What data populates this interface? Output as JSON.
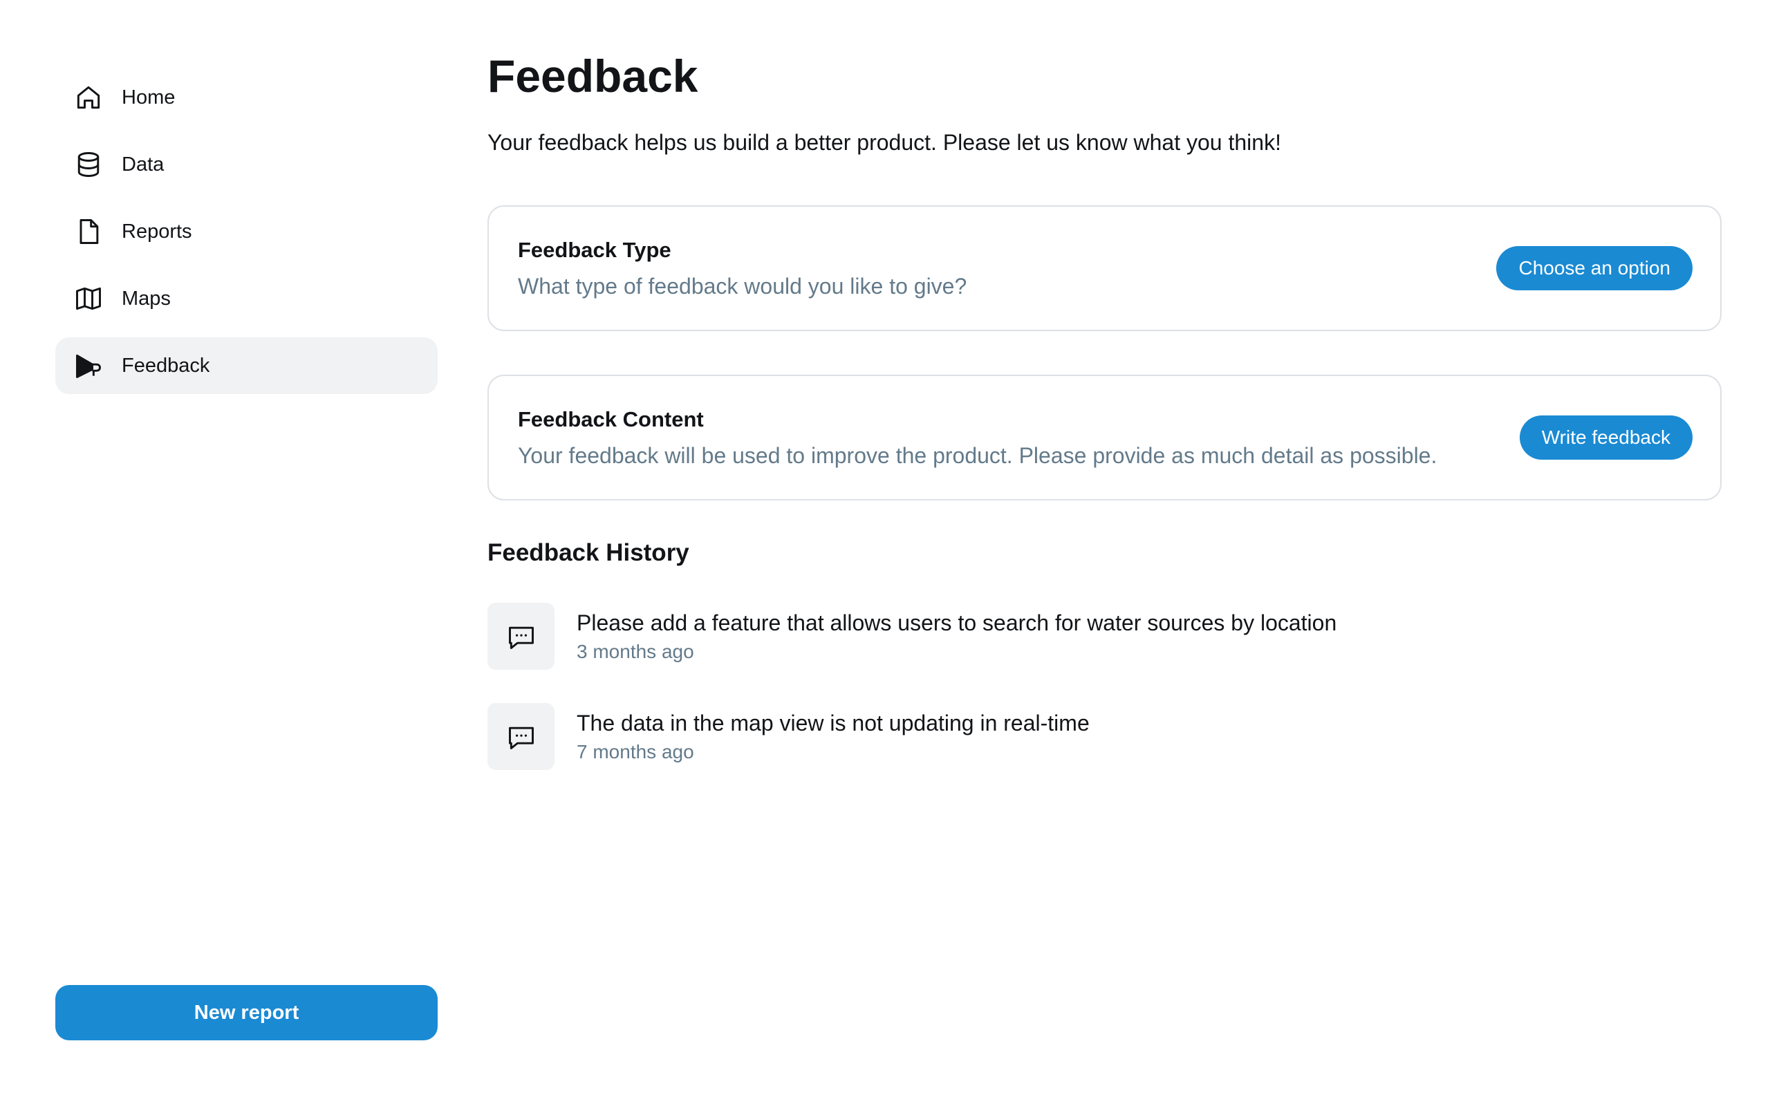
{
  "sidebar": {
    "items": [
      {
        "label": "Home",
        "icon": "home-icon",
        "active": false
      },
      {
        "label": "Data",
        "icon": "database-icon",
        "active": false
      },
      {
        "label": "Reports",
        "icon": "file-icon",
        "active": false
      },
      {
        "label": "Maps",
        "icon": "map-icon",
        "active": false
      },
      {
        "label": "Feedback",
        "icon": "megaphone-icon",
        "active": true
      }
    ],
    "new_report_label": "New report"
  },
  "main": {
    "title": "Feedback",
    "subtitle": "Your feedback helps us build a better product. Please let us know what you think!",
    "cards": [
      {
        "title": "Feedback Type",
        "description": "What type of feedback would you like to give?",
        "button_label": "Choose an option"
      },
      {
        "title": "Feedback Content",
        "description": "Your feedback will be used to improve the product. Please provide as much detail as possible.",
        "button_label": "Write feedback"
      }
    ],
    "history": {
      "title": "Feedback History",
      "items": [
        {
          "message": "Please add a feature that allows users to search for water sources by location",
          "time": "3 months ago",
          "icon": "chat-icon"
        },
        {
          "message": "The data in the map view is not updating in real-time",
          "time": "7 months ago",
          "icon": "chat-icon"
        }
      ]
    }
  },
  "colors": {
    "accent": "#1a8ad3",
    "active_bg": "#f0f2f4",
    "muted_text": "#637a8a",
    "border": "#dde1e5"
  }
}
